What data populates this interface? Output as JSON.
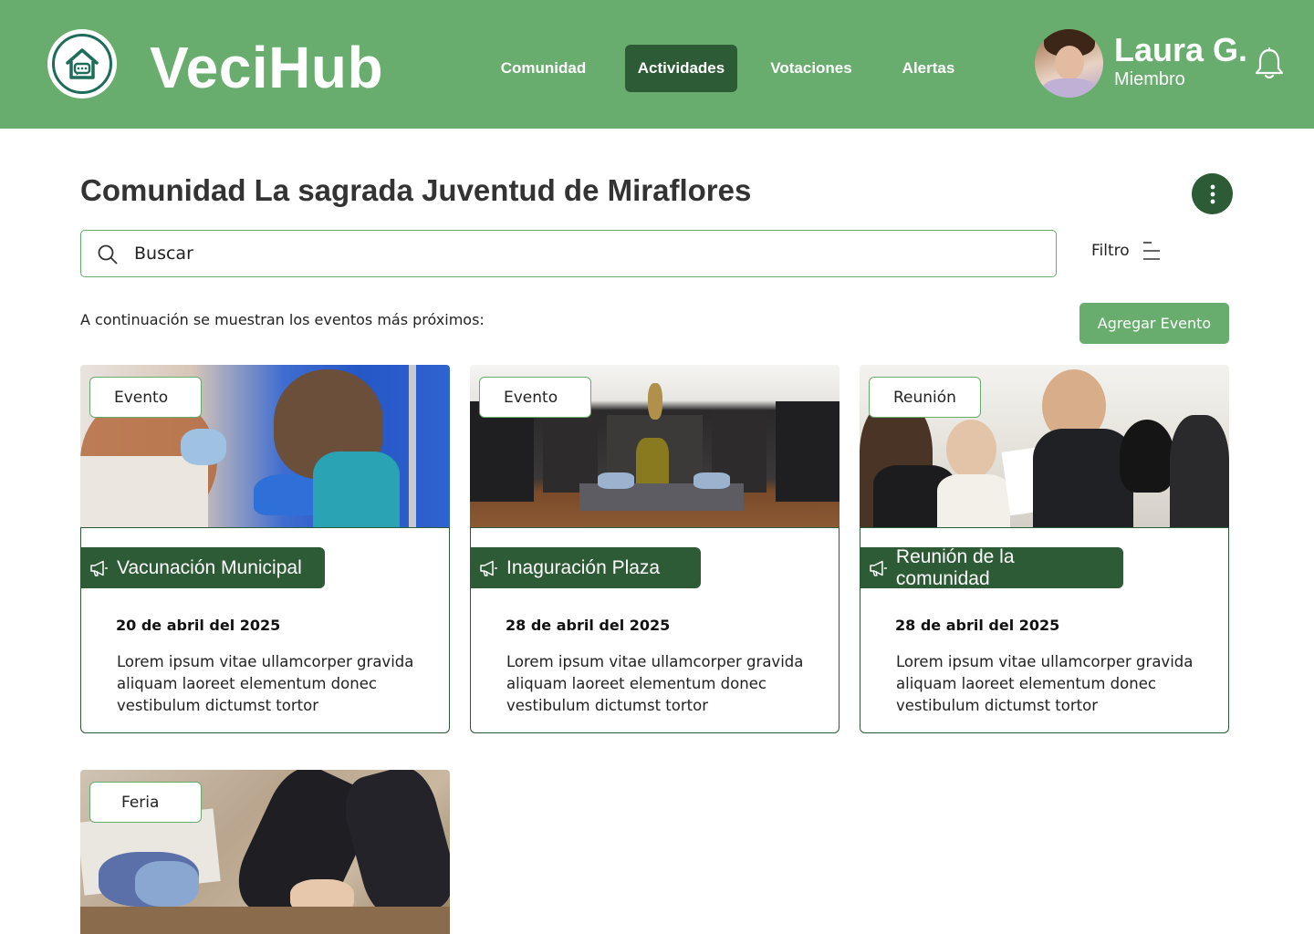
{
  "app": {
    "name": "VeciHub"
  },
  "nav": {
    "items": [
      {
        "label": "Comunidad",
        "active": false
      },
      {
        "label": "Actividades",
        "active": true
      },
      {
        "label": "Votaciones",
        "active": false
      },
      {
        "label": "Alertas",
        "active": false
      }
    ]
  },
  "user": {
    "name": "Laura G.",
    "role": "Miembro"
  },
  "page": {
    "title": "Comunidad La sagrada Juventud de Miraflores",
    "subtitle": "A continuación se muestran los eventos más próximos:"
  },
  "search": {
    "placeholder": "Buscar"
  },
  "filter": {
    "label": "Filtro"
  },
  "actions": {
    "add_event": "Agregar Evento"
  },
  "events": [
    {
      "tag": "Evento",
      "title": "Vacunación Municipal",
      "date": "20 de abril del 2025",
      "description": "Lorem ipsum vitae ullamcorper gravida aliquam laoreet elementum donec vestibulum dictumst tortor"
    },
    {
      "tag": "Evento",
      "title": "Inaguración Plaza",
      "date": "28 de abril del 2025",
      "description": "Lorem ipsum vitae ullamcorper gravida aliquam laoreet elementum donec vestibulum dictumst tortor"
    },
    {
      "tag": "Reunión",
      "title": "Reunión de la comunidad",
      "date": "28 de abril del 2025",
      "description": "Lorem ipsum vitae ullamcorper gravida aliquam laoreet elementum donec vestibulum dictumst tortor"
    },
    {
      "tag": "Feria",
      "title": "",
      "date": "",
      "description": ""
    }
  ],
  "colors": {
    "header": "#68ad6e",
    "accent_dark": "#2d5b36",
    "accent_light": "#68ad6e"
  },
  "icons": {
    "logo": "house-chat-icon",
    "bell": "bell-icon",
    "more": "more-vertical-icon",
    "search": "search-icon",
    "filter": "filter-lines-icon",
    "event_title": "megaphone-icon"
  }
}
